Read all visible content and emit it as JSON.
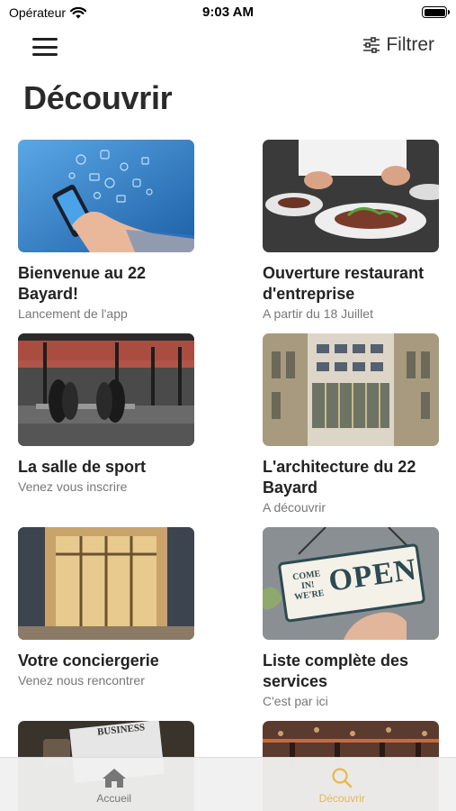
{
  "status": {
    "carrier": "Opérateur",
    "time": "9:03 AM"
  },
  "header": {
    "filter_label": "Filtrer",
    "title": "Découvrir"
  },
  "cards": [
    {
      "title": "Bienvenue au 22 Bayard!",
      "subtitle": "Lancement de l'app"
    },
    {
      "title": "Ouverture restaurant d'entreprise",
      "subtitle": "A partir du 18 Juillet"
    },
    {
      "title": "La salle de sport",
      "subtitle": "Venez vous inscrire"
    },
    {
      "title": "L'architecture du 22 Bayard",
      "subtitle": "A découvrir"
    },
    {
      "title": "Votre conciergerie",
      "subtitle": "Venez nous rencontrer"
    },
    {
      "title": "Liste complète des services",
      "subtitle": "C'est par ici"
    }
  ],
  "sign": {
    "line1": "COME IN!",
    "line2": "WE'RE",
    "word": "OPEN"
  },
  "newspaper": {
    "masthead": "BUSINESS"
  },
  "tabs": [
    {
      "label": "Accueil",
      "icon": "home-icon",
      "active": false
    },
    {
      "label": "Découvrir",
      "icon": "search-icon",
      "active": true
    }
  ],
  "colors": {
    "active_tab": "#e8b84a",
    "inactive_tab": "#777777",
    "text": "#222222",
    "subtitle": "#777777"
  }
}
